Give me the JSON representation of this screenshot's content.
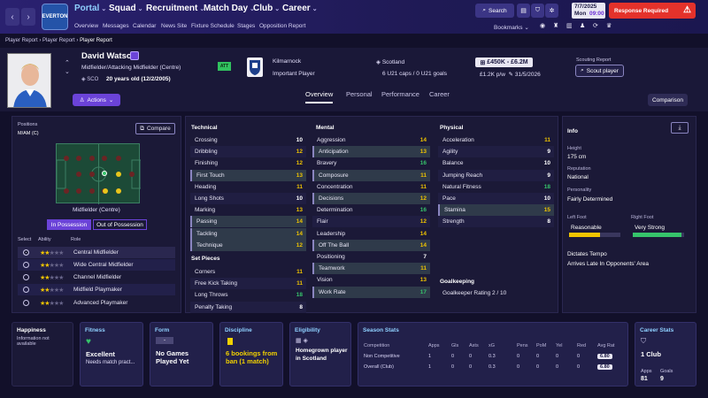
{
  "nav": {
    "crest": "EVERTON",
    "menus": [
      "Portal",
      "Squad",
      "Recruitment",
      "Match Day",
      "Club",
      "Career"
    ],
    "submenus": [
      "Overview",
      "Messages",
      "Calendar",
      "News Site",
      "Fixture Schedule",
      "Stages",
      "Opposition Report"
    ],
    "search": "Search",
    "date": "7/7/2025",
    "day": "Mon",
    "time": "09:00",
    "alert": "Response Required",
    "bookmarks": "Bookmarks"
  },
  "breadcrumb": [
    "Player Report",
    "Player Report",
    "Player Report"
  ],
  "player": {
    "name": "David Watson",
    "position": "Midfielder/Attacking Midfielder (Centre)",
    "nation": "SCO",
    "age": "20 years old (12/2/2005)",
    "actions": "Actions",
    "club": "Kilmarnock",
    "status": "Important Player",
    "country": "Scotland",
    "caps": "6 U21 caps / 0 U21 goals",
    "value": "£450K - £6.2M",
    "wage": "£1.2K p/w",
    "contract": "31/5/2026",
    "scouting_label": "Scouting Report",
    "scout_btn": "Scout player",
    "badge": "ATT"
  },
  "tabs": [
    "Overview",
    "Personal",
    "Performance",
    "Career"
  ],
  "comparison": "Comparison",
  "positions": {
    "label": "Positions",
    "value": "M/AM (C)",
    "compare": "Compare",
    "role_label": "Midfielder (Centre)",
    "in_poss": "In Possession",
    "out_poss": "Out of Possession",
    "headers": [
      "Select",
      "Ability",
      "Role"
    ],
    "roles": [
      {
        "name": "Central Midfielder",
        "stars": 2
      },
      {
        "name": "Wide Central Midfielder",
        "stars": 2
      },
      {
        "name": "Channel Midfielder",
        "stars": 2
      },
      {
        "name": "Midfield Playmaker",
        "stars": 2
      },
      {
        "name": "Advanced Playmaker",
        "stars": 2
      }
    ]
  },
  "technical": {
    "title": "Technical",
    "items": [
      {
        "n": "Crossing",
        "v": "10"
      },
      {
        "n": "Dribbling",
        "v": "12"
      },
      {
        "n": "Finishing",
        "v": "12"
      },
      {
        "n": "First Touch",
        "v": "13"
      },
      {
        "n": "Heading",
        "v": "11"
      },
      {
        "n": "Long Shots",
        "v": "10"
      },
      {
        "n": "Marking",
        "v": "13"
      },
      {
        "n": "Passing",
        "v": "14"
      },
      {
        "n": "Tackling",
        "v": "14"
      },
      {
        "n": "Technique",
        "v": "12"
      }
    ]
  },
  "setpieces": {
    "title": "Set Pieces",
    "items": [
      {
        "n": "Corners",
        "v": "11"
      },
      {
        "n": "Free Kick Taking",
        "v": "11"
      },
      {
        "n": "Long Throws",
        "v": "18"
      },
      {
        "n": "Penalty Taking",
        "v": "8"
      }
    ]
  },
  "mental": {
    "title": "Mental",
    "items": [
      {
        "n": "Aggression",
        "v": "14"
      },
      {
        "n": "Anticipation",
        "v": "13"
      },
      {
        "n": "Bravery",
        "v": "16"
      },
      {
        "n": "Composure",
        "v": "11"
      },
      {
        "n": "Concentration",
        "v": "11"
      },
      {
        "n": "Decisions",
        "v": "12"
      },
      {
        "n": "Determination",
        "v": "16"
      },
      {
        "n": "Flair",
        "v": "12"
      },
      {
        "n": "Leadership",
        "v": "14"
      },
      {
        "n": "Off The Ball",
        "v": "14"
      },
      {
        "n": "Positioning",
        "v": "7"
      },
      {
        "n": "Teamwork",
        "v": "11"
      },
      {
        "n": "Vision",
        "v": "13"
      },
      {
        "n": "Work Rate",
        "v": "17"
      }
    ]
  },
  "physical": {
    "title": "Physical",
    "items": [
      {
        "n": "Acceleration",
        "v": "11"
      },
      {
        "n": "Agility",
        "v": "9"
      },
      {
        "n": "Balance",
        "v": "10"
      },
      {
        "n": "Jumping Reach",
        "v": "9"
      },
      {
        "n": "Natural Fitness",
        "v": "18"
      },
      {
        "n": "Pace",
        "v": "10"
      },
      {
        "n": "Stamina",
        "v": "15"
      },
      {
        "n": "Strength",
        "v": "8"
      }
    ]
  },
  "goalkeeping": {
    "title": "Goalkeeping",
    "rating": "Goalkeeper Rating  2 / 10"
  },
  "info": {
    "title": "Info",
    "height_l": "Height",
    "height": "175 cm",
    "rep_l": "Reputation",
    "rep": "National",
    "pers_l": "Personality",
    "pers": "Fairly Determined",
    "lf_l": "Left Foot",
    "lf": "Reasonable",
    "rf_l": "Right Foot",
    "rf": "Very Strong",
    "traits": [
      "Dictates Tempo",
      "Arrives Late In Opponents' Area"
    ]
  },
  "cards": {
    "happiness": {
      "title": "Happiness",
      "text": "Information not available"
    },
    "fitness": {
      "title": "Fitness",
      "value": "Excellent",
      "sub": "Needs match pract..."
    },
    "form": {
      "title": "Form",
      "chip": "-",
      "value": "No Games Played Yet"
    },
    "discipline": {
      "title": "Discipline",
      "value": "6 bookings from ban (1 match)"
    },
    "eligibility": {
      "title": "Eligibility",
      "value": "Homegrown player in Scotland"
    },
    "season": {
      "title": "Season Stats",
      "headers": [
        "Competition",
        "Apps",
        "Gls",
        "Asts",
        "xG",
        "Pens",
        "PoM",
        "Yel",
        "Red",
        "Avg Rat"
      ],
      "rows": [
        [
          "Non Competitive",
          "1",
          "0",
          "0",
          "0.3",
          "0",
          "0",
          "0",
          "0",
          "6.80"
        ],
        [
          "Overall (Club)",
          "1",
          "0",
          "0",
          "0.3",
          "0",
          "0",
          "0",
          "0",
          "6.80"
        ]
      ]
    },
    "career": {
      "title": "Career Stats",
      "club": "1 Club",
      "apps_l": "Apps",
      "apps": "81",
      "goals_l": "Goals",
      "goals": "9"
    }
  },
  "colors": {
    "accent": "#6b43d8",
    "alert": "#e4322b",
    "highlight": "#8fd0ff"
  }
}
